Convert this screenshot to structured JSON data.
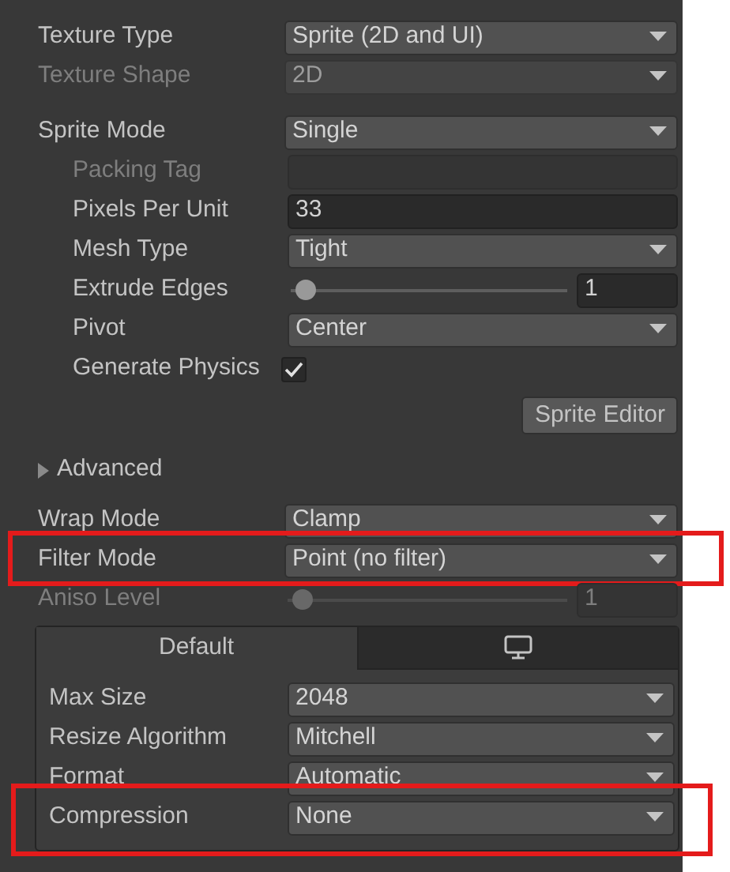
{
  "settings": [
    {
      "kind": "dropdown",
      "label": "Texture Type",
      "value": "Sprite (2D and UI)",
      "disabled": false
    },
    {
      "kind": "dropdown",
      "label": "Texture Shape",
      "value": "2D",
      "disabled": true
    },
    {
      "kind": "dropdown",
      "label": "Sprite Mode",
      "value": "Single",
      "disabled": false,
      "gap_before": true,
      "children": [
        {
          "kind": "text_field",
          "label": "Packing Tag",
          "disabled": true
        },
        {
          "kind": "text_field",
          "label": "Pixels Per Unit",
          "value": "33",
          "disabled": false
        },
        {
          "kind": "dropdown",
          "label": "Mesh Type",
          "value": "Tight",
          "disabled": false
        },
        {
          "kind": "slider",
          "label": "Extrude Edges",
          "level": 0.05,
          "value": "1",
          "disabled": false
        },
        {
          "kind": "dropdown",
          "label": "Pivot",
          "value": "Center",
          "disabled": false
        },
        {
          "kind": "checkbox",
          "label": "Generate Physics",
          "checked": true,
          "disabled": false
        }
      ]
    },
    {
      "kind": "button",
      "label": "Sprite Editor"
    },
    {
      "kind": "foldout",
      "label": "Advanced",
      "expanded": false
    },
    {
      "kind": "dropdown",
      "label": "Wrap Mode",
      "value": "Clamp",
      "disabled": false
    },
    {
      "kind": "dropdown",
      "label": "Filter Mode",
      "value": "Point (no filter)",
      "disabled": false,
      "highlighted": true
    },
    {
      "kind": "slider",
      "label": "Aniso Level",
      "level": 0.05,
      "value": "1",
      "disabled": true
    }
  ],
  "platform_tabs": [
    {
      "kind": "text",
      "label": "Default",
      "selected": true
    },
    {
      "kind": "monitor",
      "selected": false
    }
  ],
  "platform_settings": [
    {
      "kind": "dropdown",
      "label": "Max Size",
      "value": "2048",
      "disabled": false
    },
    {
      "kind": "dropdown",
      "label": "Resize Algorithm",
      "value": "Mitchell",
      "disabled": false
    },
    {
      "kind": "dropdown",
      "label": "Format",
      "value": "Automatic",
      "disabled": false
    },
    {
      "kind": "dropdown",
      "label": "Compression",
      "value": "None",
      "disabled": false,
      "highlighted": true
    }
  ]
}
